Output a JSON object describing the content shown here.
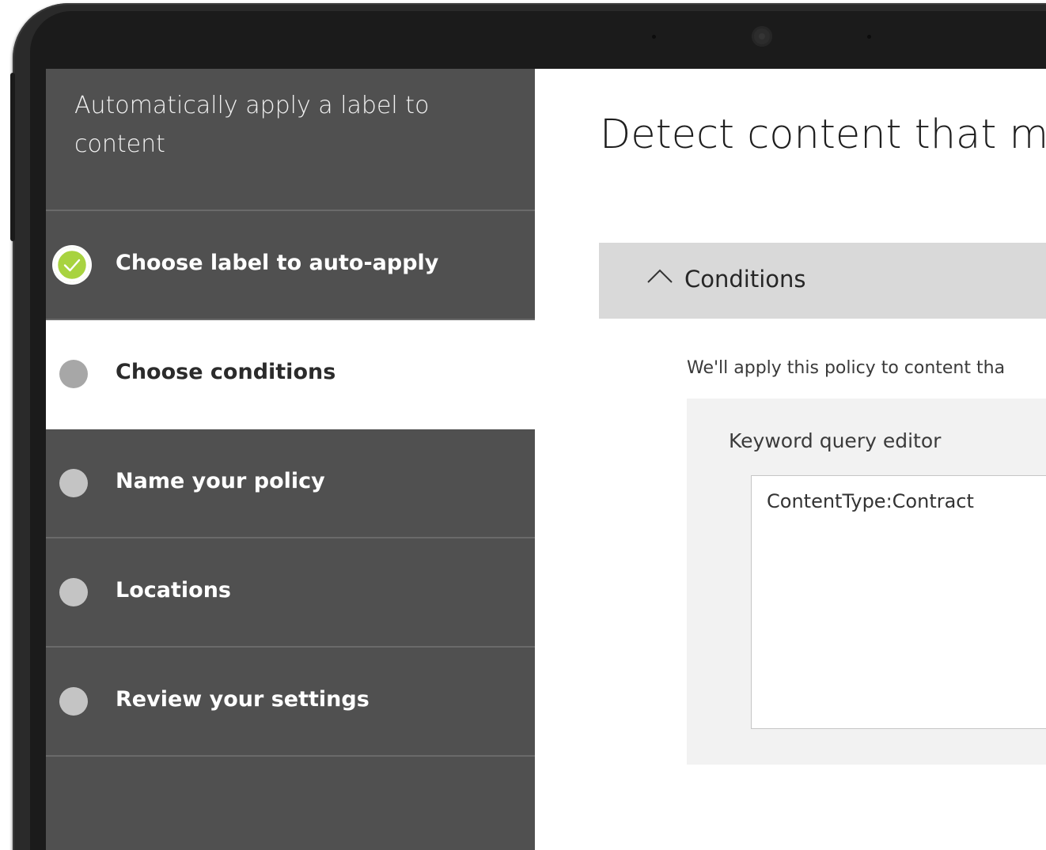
{
  "colors": {
    "bezel": "#2a2a2a",
    "wizard_background": "#505050",
    "active_step_background": "#ffffff",
    "completed_indicator": "#a8d33f",
    "pending_indicator": "#c4c4c4",
    "conditions_header_background": "#d9d9d9",
    "editor_panel_background": "#f2f2f2"
  },
  "wizard": {
    "title": "Automatically apply a label to content",
    "steps": [
      {
        "label": "Choose label to auto-apply",
        "status": "completed",
        "icon": "check-circle-icon"
      },
      {
        "label": "Choose conditions",
        "status": "current",
        "icon": "step-dot-icon"
      },
      {
        "label": "Name your policy",
        "status": "pending",
        "icon": "step-dot-icon"
      },
      {
        "label": "Locations",
        "status": "pending",
        "icon": "step-dot-icon"
      },
      {
        "label": "Review your settings",
        "status": "pending",
        "icon": "step-dot-icon"
      }
    ]
  },
  "main": {
    "title": "Detect content that mat",
    "conditions": {
      "header": "Conditions",
      "icon": "chevron-up-icon",
      "description": "We'll apply this policy to content tha",
      "editor_label": "Keyword query editor",
      "editor_value": "ContentType:Contract"
    }
  }
}
